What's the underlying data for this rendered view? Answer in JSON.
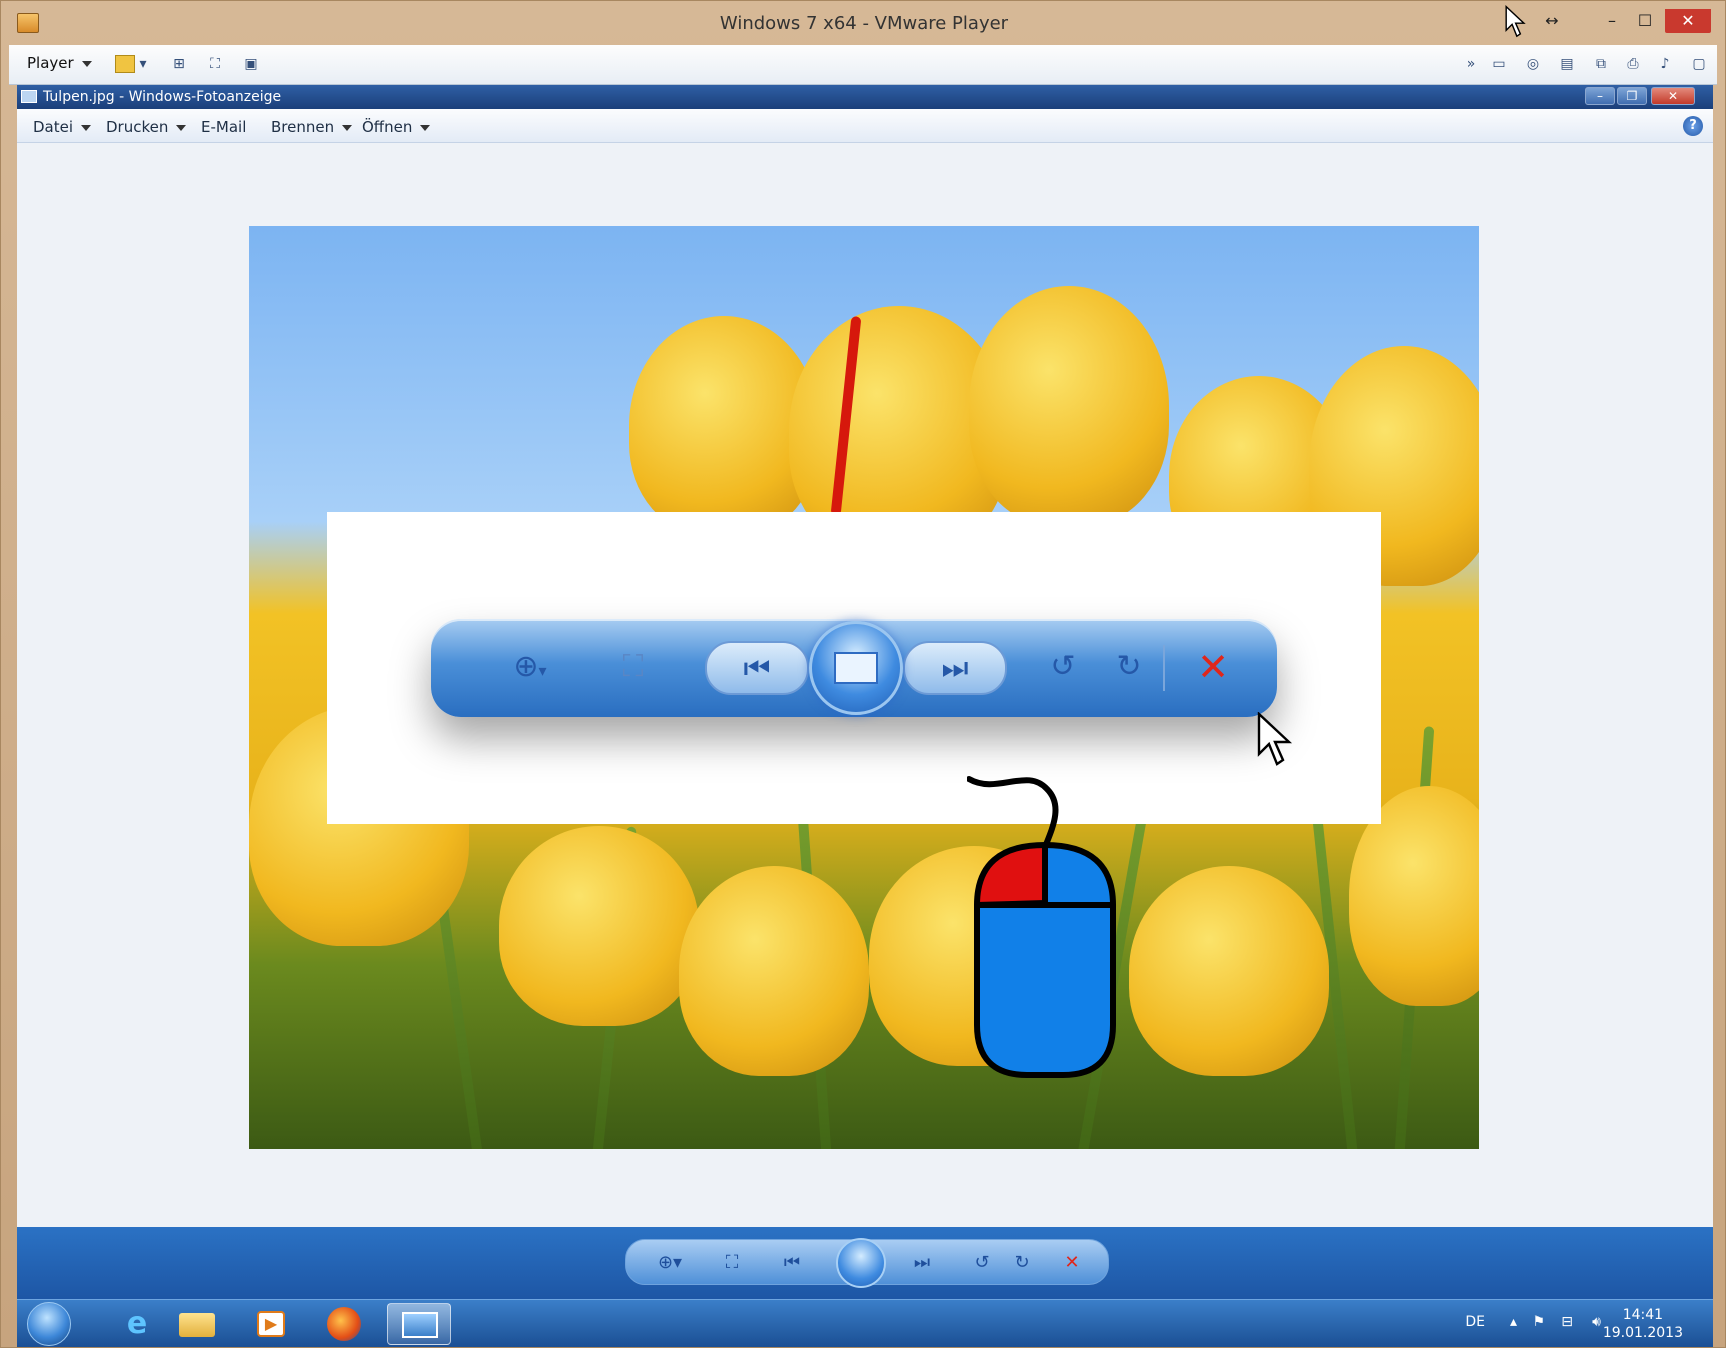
{
  "vm": {
    "title": "Windows 7 x64 - VMware Player",
    "player_menu": "Player",
    "controls": {
      "minimize": "–",
      "maximize": "☐",
      "close": "✕",
      "resize": "↔"
    }
  },
  "viewer": {
    "title": "Tulpen.jpg - Windows-Fotoanzeige",
    "menu": [
      "Datei",
      "Drucken",
      "E-Mail",
      "Brennen",
      "Öffnen"
    ],
    "help": "?"
  },
  "toolbar": {
    "zoom_icon": "magnifier-plus-icon",
    "actual_size_icon": "actual-size-icon",
    "previous_icon": "previous-icon",
    "slideshow_icon": "slideshow-icon",
    "next_icon": "next-icon",
    "rotate_ccw_icon": "rotate-counterclockwise-icon",
    "rotate_cw_icon": "rotate-clockwise-icon",
    "delete_icon": "delete-icon",
    "delete_color": "#e0261b"
  },
  "taskbar": {
    "language": "DE",
    "time": "14:41",
    "date": "19.01.2013"
  },
  "colors": {
    "mouse_left_button": "#e01010",
    "mouse_body": "#1180e8",
    "vm_close": "#c9392e"
  }
}
